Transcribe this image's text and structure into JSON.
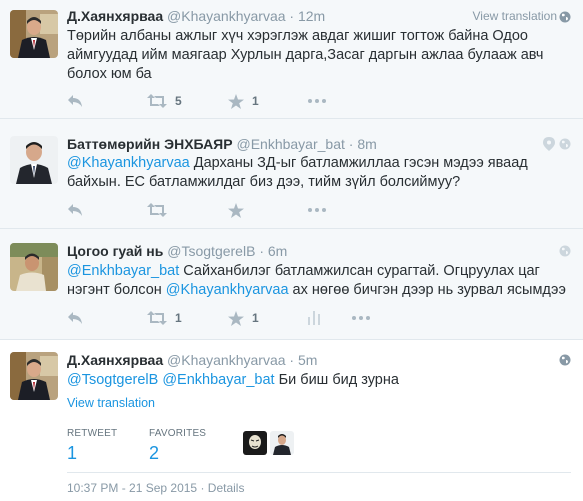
{
  "tweets": [
    {
      "fullname": "Д.Хаянхярваа",
      "username": "@Khayankhyarvaa",
      "time": "· 12m",
      "view_translation": "View translation",
      "text": "Төрийн албаны ажлыг хүч хэрэглэж авдаг жишиг тогтож байна Одоо аймгуудад ийм маягаар Хурлын дарга,Засаг даргын ажлаа булааж авч болох юм ба",
      "retweets": "5",
      "favorites": "1"
    },
    {
      "fullname": "Баттөмөрийн ЭНХБАЯР",
      "username": "@Enkhbayar_bat",
      "time": "· 8m",
      "mention": "@Khayankhyarvaa",
      "text": " Дарханы ЗД-ыг батламжиллаа гэсэн мэдээ яваад байхын. ЕС батламжилдаг биз дээ, тийм зүйл болсиймуу?"
    },
    {
      "fullname": "Цогоо гуай нь",
      "username": "@TsogtgerelB",
      "time": "· 6m",
      "mention1": "@Enkhbayar_bat",
      "text1": " Сайханбилэг батламжилсан сурагтай. Огцруулах цаг нэгэнт болсон  ",
      "mention2": "@Khayankhyarvaa",
      "text2": " ах нөгөө бичгэн дээр нь зурвал ясымдээ",
      "retweets": "1",
      "favorites": "1"
    },
    {
      "fullname": "Д.Хаянхярваа",
      "username": "@Khayankhyarvaa",
      "time": "· 5m",
      "mention1": "@TsogtgerelB",
      "mention2": "@Enkhbayar_bat",
      "text": " Би биш бид зурна",
      "view_translation": "View translation",
      "retweet_label": "RETWEET",
      "retweet_count": "1",
      "favorites_label": "FAVORITES",
      "favorites_count": "2",
      "timestamp": "10:37 PM - 21 Sep 2015",
      "details": "Details"
    }
  ],
  "colors": {
    "link": "#1b95e0",
    "meta": "#8899a6",
    "text": "#292f33",
    "icon": "#aab8c2",
    "bg_parent": "#f5f8fa"
  }
}
